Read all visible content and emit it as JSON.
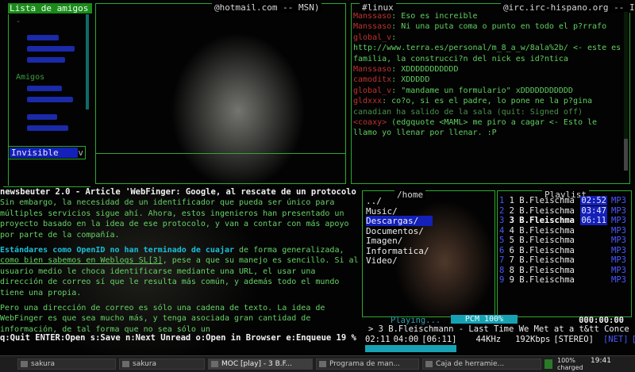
{
  "buddy_list": {
    "title": "Lista de amigos",
    "groups": [
      " ",
      "Amigos",
      " "
    ],
    "status": "Invisible",
    "status_arrow": "v"
  },
  "msn": {
    "title": "@hotmail.com -- MSN)"
  },
  "irc": {
    "title": "#linux",
    "server": "@irc.irc-hispano.org -- IRC)",
    "lines": [
      {
        "nick": "Manssaso",
        "text": ": Eso es increible"
      },
      {
        "nick": "Manssaso",
        "text": ": Ni una puta coma o punto en todo el p?rrafo"
      },
      {
        "nick": "global_v",
        "text": ":"
      },
      {
        "nick": "",
        "text": "http://www.terra.es/personal/m_8_a_w/8ala%2b/ <- este es familia, la construcci?n del nick es id?ntica"
      },
      {
        "nick": "Manssaso",
        "text": ": XDDDDDDDDDDD"
      },
      {
        "nick": "camoditx",
        "text": ": XDDDDD"
      },
      {
        "nick": "global_v",
        "text": ": \"mandame un formulario\" xDDDDDDDDDDD"
      },
      {
        "nick": "gldxxx",
        "text": ": co?o, si es el padre, lo pone ne la p?gina"
      },
      {
        "nick": "",
        "text": "canadian ha salido de la sala (quit: Signed off)",
        "sys": true
      },
      {
        "nick": "<coaxy>",
        "text": " (edgquote <MAML> me piro a cagar <- Esto le llamo yo llenar por llenar. :P"
      }
    ]
  },
  "newsbeuter": {
    "title": "newsbeuter 2.0 - Article 'WebFinger: Google, al rescate de un protocolo",
    "para1": "Sin embargo, la necesidad de un identificador que pueda ser único para múltiples servicios sigue ahí. Ahora, estos ingenieros han presentado un proyecto basado en la idea de ese protocolo, y van a contar con más apoyo por parte de la compañía.",
    "para2_hl": "Estándares como OpenID no han terminado de cuajar",
    "para2_a": " de forma generalizada, ",
    "para2_link": "como bien sabemos en Weblogs SL[3]",
    "para2_b": ", pese a que su manejo es sencillo. Si al usuario medio le choca identificarse mediante una URL, el usar una dirección de correo sí que le resulta más común, y además todo el mundo tiene una propia.",
    "para3": "Pero una dirección de correo es sólo una cadena de texto. La idea de WebFinger es que sea mucho más, y tenga asociada gran cantidad de información, de tal forma que no sea sólo un",
    "footer": "q:Quit ENTER:Open s:Save n:Next Unread o:Open in Browser e:Enqueue 19 %"
  },
  "moc": {
    "dir_title": "/home",
    "dir_entries": [
      "../",
      "Music/",
      "Descargas/",
      "Documentos/",
      "Imagen/",
      "Informatica/",
      "Video/"
    ],
    "selected_index": 2,
    "playlist_title": "Playlist",
    "playlist": [
      {
        "n": "1",
        "name": "1 B.Fleischma",
        "time": "02:52",
        "fmt": "MP3"
      },
      {
        "n": "2",
        "name": "2 B.Fleischma",
        "time": "03:47",
        "fmt": "MP3"
      },
      {
        "n": "3",
        "name": "3 B.Fleischma",
        "time": "06:11",
        "fmt": "MP3"
      },
      {
        "n": "4",
        "name": "4 B.Fleischma",
        "time": "",
        "fmt": "MP3"
      },
      {
        "n": "5",
        "name": "5 B.Fleischma",
        "time": "",
        "fmt": "MP3"
      },
      {
        "n": "6",
        "name": "6 B.Fleischma",
        "time": "",
        "fmt": "MP3"
      },
      {
        "n": "7",
        "name": "7 B.Fleischma",
        "time": "",
        "fmt": "MP3"
      },
      {
        "n": "8",
        "name": "8 B.Fleischma",
        "time": "",
        "fmt": "MP3"
      },
      {
        "n": "9",
        "name": "9 B.Fleischma",
        "time": "",
        "fmt": "MP3"
      }
    ],
    "current_index": 2,
    "playing_label": "Playing...",
    "pcm": "PCM 100%",
    "timer": "000:00:00",
    "now_playing": "> 3 B.Fleischmann - Last Time We Met at a t&tt Conce",
    "elapsed": "02:11",
    "left": "04:00",
    "total": "[06:11]",
    "rate": "44KHz",
    "bitrate": "192Kbps",
    "channels": "[STEREO]",
    "net": "[NET]",
    "shuffle": "[S",
    "progress_fraction": 0.35
  },
  "taskbar": {
    "tasks": [
      "sakura",
      "sakura",
      "MOC [play] - 3 B.F...",
      "Programa de man...",
      "Caja de herramie..."
    ],
    "active_index": 2,
    "battery": "100%",
    "battery_state": "charged",
    "clock": "19:41"
  },
  "colors": {
    "frame": "#2ea82e",
    "text": "#66d266",
    "highlight": "#1420b8",
    "moc_accent": "#17a2b4",
    "nick": "#c0322e"
  }
}
